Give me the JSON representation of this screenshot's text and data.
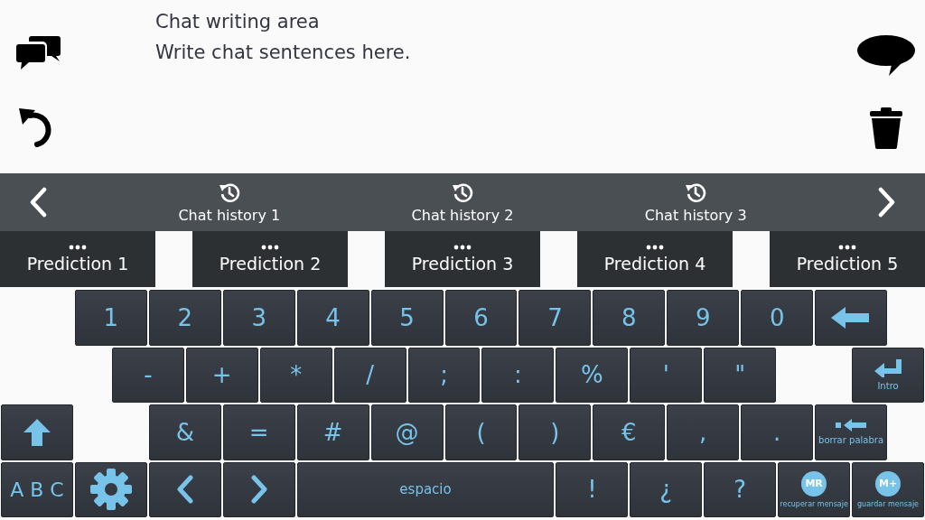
{
  "writing_area": {
    "title": "Chat writing area",
    "placeholder": "Write chat sentences here."
  },
  "history_bar": {
    "items": [
      "Chat history 1",
      "Chat history 2",
      "Chat history 3"
    ]
  },
  "predictions": [
    "Prediction 1",
    "Prediction 2",
    "Prediction 3",
    "Prediction 4",
    "Prediction 5"
  ],
  "keyboard": {
    "rows": [
      [
        {
          "kind": "char",
          "label": "1"
        },
        {
          "kind": "char",
          "label": "2"
        },
        {
          "kind": "char",
          "label": "3"
        },
        {
          "kind": "char",
          "label": "4"
        },
        {
          "kind": "char",
          "label": "5"
        },
        {
          "kind": "char",
          "label": "6"
        },
        {
          "kind": "char",
          "label": "7"
        },
        {
          "kind": "char",
          "label": "8"
        },
        {
          "kind": "char",
          "label": "9"
        },
        {
          "kind": "char",
          "label": "0"
        },
        {
          "kind": "backspace"
        }
      ],
      [
        {
          "kind": "char",
          "label": "-"
        },
        {
          "kind": "char",
          "label": "+"
        },
        {
          "kind": "char",
          "label": "*"
        },
        {
          "kind": "char",
          "label": "/"
        },
        {
          "kind": "char",
          "label": ";"
        },
        {
          "kind": "char",
          "label": ":"
        },
        {
          "kind": "char",
          "label": "%"
        },
        {
          "kind": "char",
          "label": "'"
        },
        {
          "kind": "char",
          "label": "\""
        },
        {
          "kind": "enter",
          "label": "Intro"
        }
      ],
      [
        {
          "kind": "shift"
        },
        {
          "kind": "char",
          "label": "&"
        },
        {
          "kind": "char",
          "label": "="
        },
        {
          "kind": "char",
          "label": "#"
        },
        {
          "kind": "char",
          "label": "@"
        },
        {
          "kind": "char",
          "label": "("
        },
        {
          "kind": "char",
          "label": ")"
        },
        {
          "kind": "char",
          "label": "€"
        },
        {
          "kind": "char",
          "label": ","
        },
        {
          "kind": "char",
          "label": "."
        },
        {
          "kind": "delete-word",
          "label": "borrar palabra"
        }
      ],
      [
        {
          "kind": "abc",
          "label": "A B C"
        },
        {
          "kind": "settings"
        },
        {
          "kind": "left"
        },
        {
          "kind": "right"
        },
        {
          "kind": "space",
          "label": "espacio"
        },
        {
          "kind": "char",
          "label": "!"
        },
        {
          "kind": "char",
          "label": "¿"
        },
        {
          "kind": "char",
          "label": "?"
        },
        {
          "kind": "memory",
          "badge": "MR",
          "label": "recuperar mensaje"
        },
        {
          "kind": "memory",
          "badge": "M+",
          "label": "guardar mensaje"
        }
      ]
    ]
  }
}
